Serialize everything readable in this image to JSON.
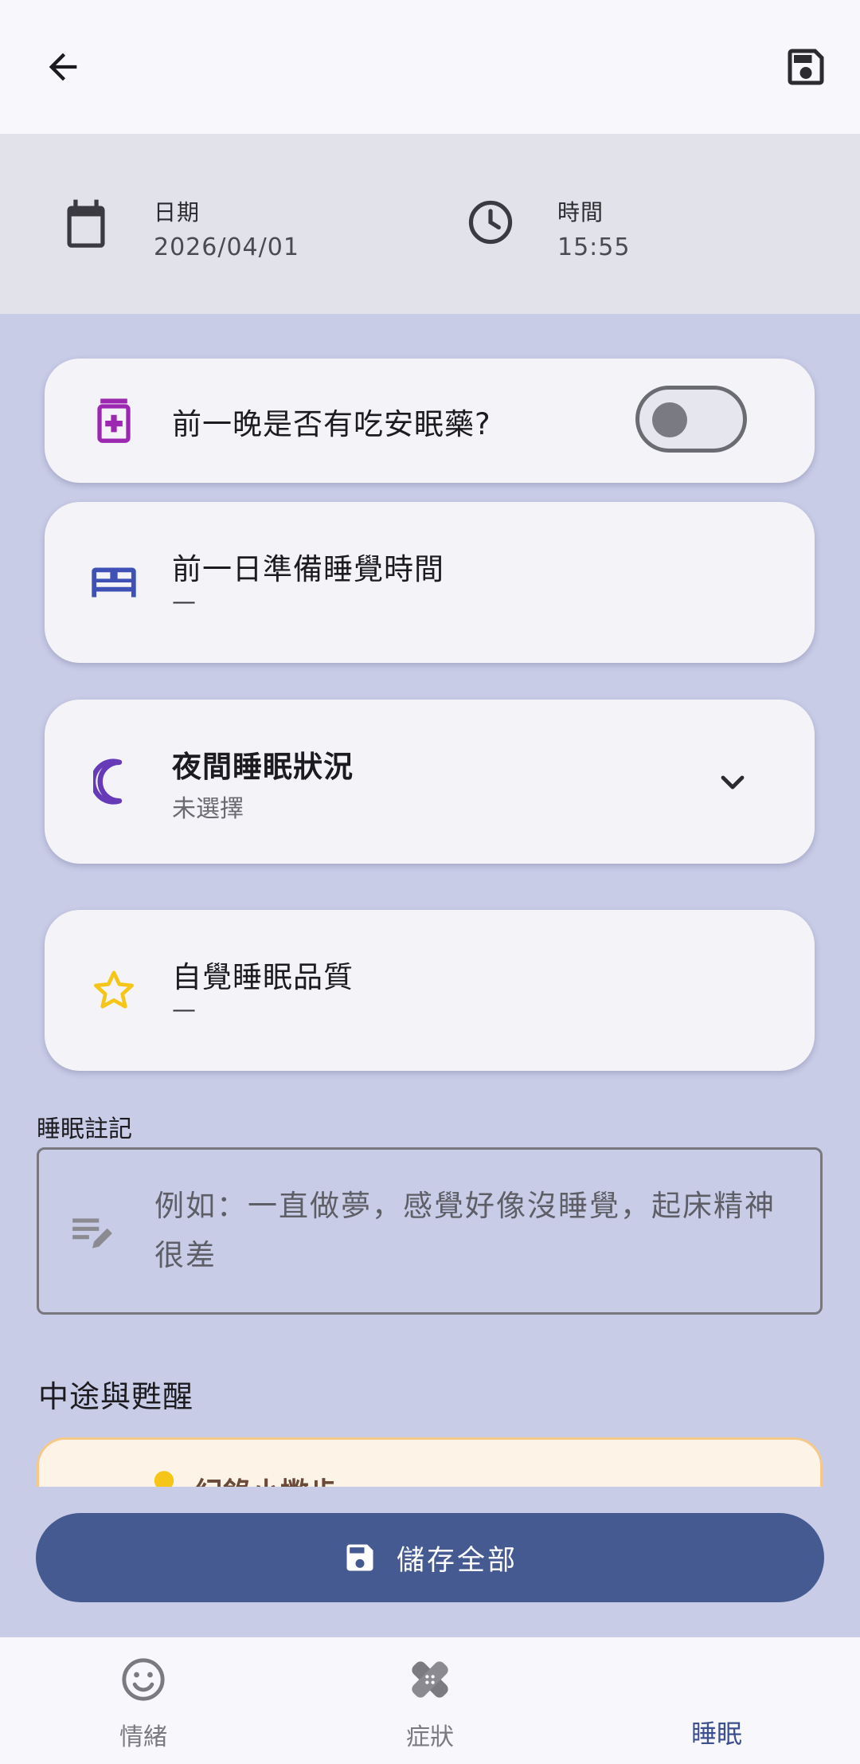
{
  "header": {
    "back_icon": "arrow-left-icon",
    "save_icon": "floppy-disk-icon"
  },
  "datetime": {
    "date_label": "日期",
    "date_value": "2026/04/01",
    "time_label": "時間",
    "time_value": "15:55"
  },
  "cards": {
    "sleeping_pill": {
      "title": "前一晚是否有吃安眠藥?",
      "toggle_on": false,
      "icon": "medicine-bottle-icon",
      "icon_color": "#9c27b0"
    },
    "bedtime": {
      "title": "前一日準備睡覺時間",
      "value": "—",
      "icon": "bed-icon",
      "icon_color": "#3f51b5"
    },
    "night_sleep": {
      "title": "夜間睡眠狀況",
      "value": "未選擇",
      "icon": "moon-icon",
      "icon_color": "#673ab7"
    },
    "quality": {
      "title": "自覺睡眠品質",
      "value": "—",
      "icon": "star-icon",
      "icon_color": "#f5c518"
    }
  },
  "notes": {
    "label": "睡眠註記",
    "placeholder": "例如：一直做夢，感覺好像沒睡覺，起床精神很差"
  },
  "wake_section": {
    "title": "中途與甦醒",
    "tip_text": "紀錄小撇步"
  },
  "save_all": {
    "label": "儲存全部"
  },
  "bottom_nav": {
    "items": [
      {
        "label": "情緒",
        "icon": "smiley-icon",
        "active": false
      },
      {
        "label": "症狀",
        "icon": "bandage-icon",
        "active": false
      },
      {
        "label": "睡眠",
        "icon": "moon-icon",
        "active": true
      }
    ]
  },
  "colors": {
    "background": "#c8cce7",
    "primary": "#465a92",
    "card": "#f3f3f8",
    "tip_background": "#fdf3e6",
    "tip_border": "#f4c98a"
  }
}
